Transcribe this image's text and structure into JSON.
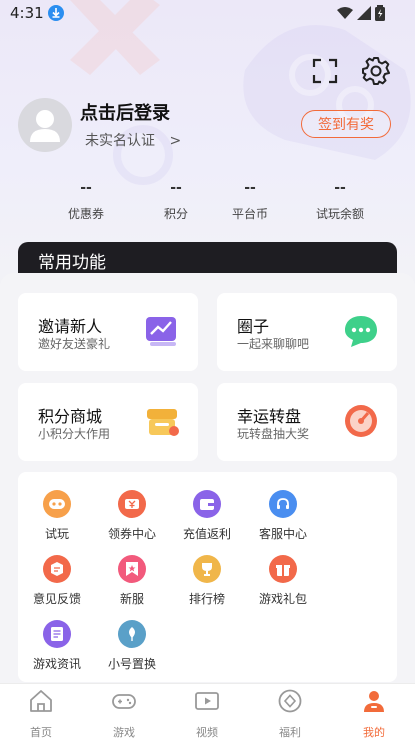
{
  "status_bar": {
    "time": "4:31"
  },
  "header": {
    "login_title": "点击后登录",
    "auth_text": "未实名认证",
    "auth_arrow": ">",
    "signin_label": "签到有奖"
  },
  "stats": [
    {
      "value": "--",
      "label": "优惠券"
    },
    {
      "value": "--",
      "label": "积分"
    },
    {
      "value": "--",
      "label": "平台币"
    },
    {
      "value": "--",
      "label": "试玩余额"
    }
  ],
  "common": {
    "title": "常用功能"
  },
  "cards": [
    {
      "title": "邀请新人",
      "subtitle": "邀好友送豪礼",
      "icon": "chart-icon"
    },
    {
      "title": "圈子",
      "subtitle": "一起来聊聊吧",
      "icon": "chat-icon"
    },
    {
      "title": "积分商城",
      "subtitle": "小积分大作用",
      "icon": "shop-icon"
    },
    {
      "title": "幸运转盘",
      "subtitle": "玩转盘抽大奖",
      "icon": "wheel-icon"
    }
  ],
  "grid": [
    {
      "label": "试玩",
      "icon": "gamepad-icon",
      "color": "#f7a04a"
    },
    {
      "label": "领券中心",
      "icon": "coupon-icon",
      "color": "#f2694a"
    },
    {
      "label": "充值返利",
      "icon": "wallet-icon",
      "color": "#8a63e8"
    },
    {
      "label": "客服中心",
      "icon": "headset-icon",
      "color": "#4a8ef0"
    },
    {
      "label": "意见反馈",
      "icon": "feedback-icon",
      "color": "#f2694a"
    },
    {
      "label": "新服",
      "icon": "badge-icon",
      "color": "#f25a7c"
    },
    {
      "label": "排行榜",
      "icon": "trophy-icon",
      "color": "#f0b64a"
    },
    {
      "label": "游戏礼包",
      "icon": "gift-icon",
      "color": "#f2694a"
    },
    {
      "label": "游戏资讯",
      "icon": "news-icon",
      "color": "#8a63e8"
    },
    {
      "label": "小号置换",
      "icon": "leaf-icon",
      "color": "#5aa0c8"
    }
  ],
  "tabs": [
    {
      "label": "首页",
      "icon": "home-icon",
      "active": false
    },
    {
      "label": "游戏",
      "icon": "gamepad-tab-icon",
      "active": false
    },
    {
      "label": "视频",
      "icon": "video-icon",
      "active": false
    },
    {
      "label": "福利",
      "icon": "welfare-icon",
      "active": false
    },
    {
      "label": "我的",
      "icon": "profile-icon",
      "active": true
    }
  ],
  "colors": {
    "accent": "#f26b3a",
    "dark_bar": "#1e1d22"
  }
}
